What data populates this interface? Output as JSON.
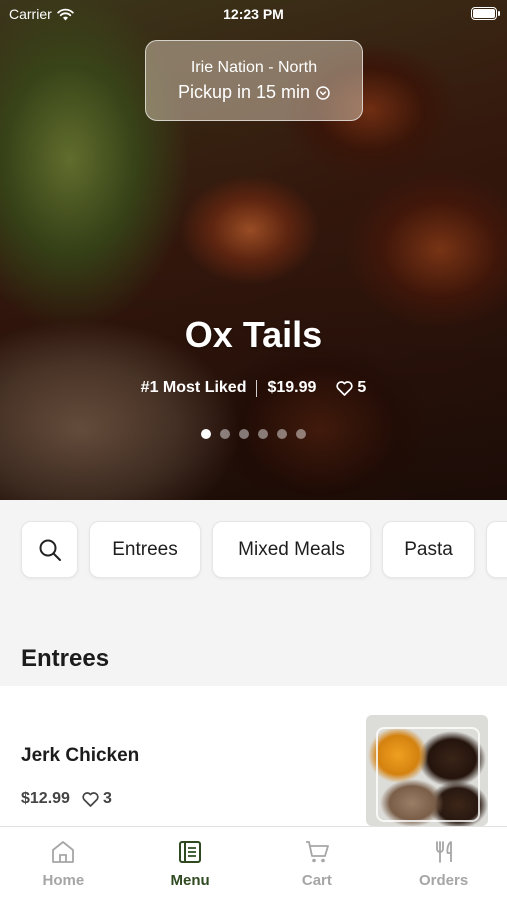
{
  "status_bar": {
    "carrier": "Carrier",
    "time": "12:23 PM"
  },
  "location": {
    "store_name": "Irie Nation - North",
    "pickup_text": "Pickup in 15 min"
  },
  "featured": {
    "title": "Ox Tails",
    "rank": "#1 Most Liked",
    "price": "$19.99",
    "likes": "5",
    "carousel_count": 6,
    "active_index": 0
  },
  "categories": [
    {
      "label": ""
    },
    {
      "label": "Entrees"
    },
    {
      "label": "Mixed Meals"
    },
    {
      "label": "Pasta"
    }
  ],
  "section": {
    "title": "Entrees"
  },
  "items": [
    {
      "name": "Jerk Chicken",
      "price": "$12.99",
      "likes": "3"
    }
  ],
  "tabs": [
    {
      "label": "Home",
      "active": false
    },
    {
      "label": "Menu",
      "active": true
    },
    {
      "label": "Cart",
      "active": false
    },
    {
      "label": "Orders",
      "active": false
    }
  ],
  "colors": {
    "accent": "#2f4a20",
    "inactive": "#a6a6a6"
  }
}
